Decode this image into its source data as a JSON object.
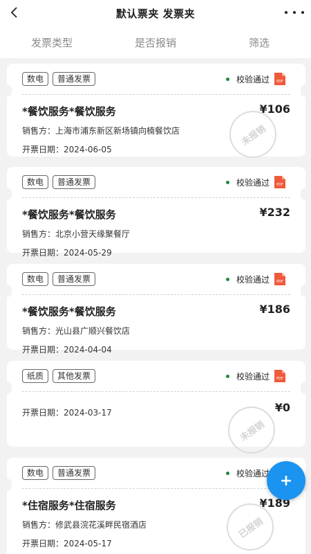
{
  "header": {
    "title": "默认票夹 发票夹"
  },
  "filters": [
    "发票类型",
    "是否报销",
    "筛选"
  ],
  "labels": {
    "seller_prefix": "销售方：",
    "date_prefix": "开票日期："
  },
  "invoices": [
    {
      "tags": [
        "数电",
        "普通发票"
      ],
      "status": "校验通过",
      "item": "*餐饮服务*餐饮服务",
      "amount": "¥106",
      "seller": "上海市浦东新区新场镇向楠餐饮店",
      "date": "2024-06-05",
      "stamp": "未报销"
    },
    {
      "tags": [
        "数电",
        "普通发票"
      ],
      "status": "校验通过",
      "item": "*餐饮服务*餐饮服务",
      "amount": "¥232",
      "seller": "北京小营天缘聚餐厅",
      "date": "2024-05-29"
    },
    {
      "tags": [
        "数电",
        "普通发票"
      ],
      "status": "校验通过",
      "item": "*餐饮服务*餐饮服务",
      "amount": "¥186",
      "seller": "光山县广顺兴餐饮店",
      "date": "2024-04-04"
    },
    {
      "tags": [
        "纸质",
        "其他发票"
      ],
      "status": "校验通过",
      "amount": "¥0",
      "date": "2024-03-17",
      "stamp": "未报销"
    },
    {
      "tags": [
        "数电",
        "普通发票"
      ],
      "status": "校验通过",
      "item": "*住宿服务*住宿服务",
      "amount": "¥189",
      "seller": "修武县浣花溪畔民宿酒店",
      "date": "2024-05-17",
      "stamp": "已报销"
    }
  ],
  "fab": {
    "label": "+"
  },
  "colors": {
    "status_dot": "#1e8a3c",
    "pdf_icon": "#f05a3c",
    "fab": "#1b93f0"
  }
}
